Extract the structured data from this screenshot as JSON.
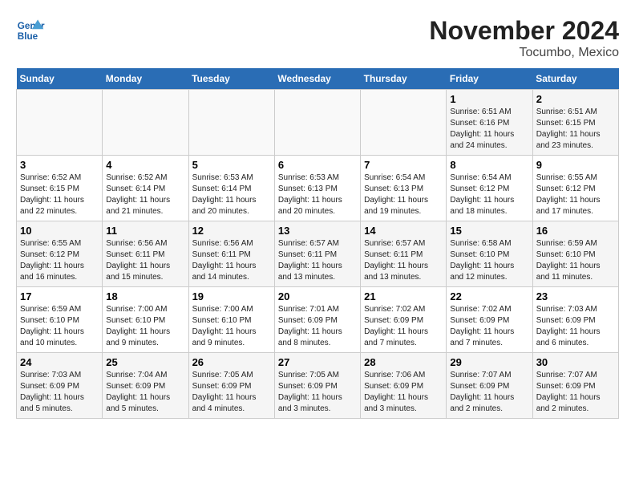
{
  "header": {
    "logo_line1": "General",
    "logo_line2": "Blue",
    "month": "November 2024",
    "location": "Tocumbo, Mexico"
  },
  "weekdays": [
    "Sunday",
    "Monday",
    "Tuesday",
    "Wednesday",
    "Thursday",
    "Friday",
    "Saturday"
  ],
  "weeks": [
    [
      {
        "day": "",
        "info": ""
      },
      {
        "day": "",
        "info": ""
      },
      {
        "day": "",
        "info": ""
      },
      {
        "day": "",
        "info": ""
      },
      {
        "day": "",
        "info": ""
      },
      {
        "day": "1",
        "info": "Sunrise: 6:51 AM\nSunset: 6:16 PM\nDaylight: 11 hours and 24 minutes."
      },
      {
        "day": "2",
        "info": "Sunrise: 6:51 AM\nSunset: 6:15 PM\nDaylight: 11 hours and 23 minutes."
      }
    ],
    [
      {
        "day": "3",
        "info": "Sunrise: 6:52 AM\nSunset: 6:15 PM\nDaylight: 11 hours and 22 minutes."
      },
      {
        "day": "4",
        "info": "Sunrise: 6:52 AM\nSunset: 6:14 PM\nDaylight: 11 hours and 21 minutes."
      },
      {
        "day": "5",
        "info": "Sunrise: 6:53 AM\nSunset: 6:14 PM\nDaylight: 11 hours and 20 minutes."
      },
      {
        "day": "6",
        "info": "Sunrise: 6:53 AM\nSunset: 6:13 PM\nDaylight: 11 hours and 20 minutes."
      },
      {
        "day": "7",
        "info": "Sunrise: 6:54 AM\nSunset: 6:13 PM\nDaylight: 11 hours and 19 minutes."
      },
      {
        "day": "8",
        "info": "Sunrise: 6:54 AM\nSunset: 6:12 PM\nDaylight: 11 hours and 18 minutes."
      },
      {
        "day": "9",
        "info": "Sunrise: 6:55 AM\nSunset: 6:12 PM\nDaylight: 11 hours and 17 minutes."
      }
    ],
    [
      {
        "day": "10",
        "info": "Sunrise: 6:55 AM\nSunset: 6:12 PM\nDaylight: 11 hours and 16 minutes."
      },
      {
        "day": "11",
        "info": "Sunrise: 6:56 AM\nSunset: 6:11 PM\nDaylight: 11 hours and 15 minutes."
      },
      {
        "day": "12",
        "info": "Sunrise: 6:56 AM\nSunset: 6:11 PM\nDaylight: 11 hours and 14 minutes."
      },
      {
        "day": "13",
        "info": "Sunrise: 6:57 AM\nSunset: 6:11 PM\nDaylight: 11 hours and 13 minutes."
      },
      {
        "day": "14",
        "info": "Sunrise: 6:57 AM\nSunset: 6:11 PM\nDaylight: 11 hours and 13 minutes."
      },
      {
        "day": "15",
        "info": "Sunrise: 6:58 AM\nSunset: 6:10 PM\nDaylight: 11 hours and 12 minutes."
      },
      {
        "day": "16",
        "info": "Sunrise: 6:59 AM\nSunset: 6:10 PM\nDaylight: 11 hours and 11 minutes."
      }
    ],
    [
      {
        "day": "17",
        "info": "Sunrise: 6:59 AM\nSunset: 6:10 PM\nDaylight: 11 hours and 10 minutes."
      },
      {
        "day": "18",
        "info": "Sunrise: 7:00 AM\nSunset: 6:10 PM\nDaylight: 11 hours and 9 minutes."
      },
      {
        "day": "19",
        "info": "Sunrise: 7:00 AM\nSunset: 6:10 PM\nDaylight: 11 hours and 9 minutes."
      },
      {
        "day": "20",
        "info": "Sunrise: 7:01 AM\nSunset: 6:09 PM\nDaylight: 11 hours and 8 minutes."
      },
      {
        "day": "21",
        "info": "Sunrise: 7:02 AM\nSunset: 6:09 PM\nDaylight: 11 hours and 7 minutes."
      },
      {
        "day": "22",
        "info": "Sunrise: 7:02 AM\nSunset: 6:09 PM\nDaylight: 11 hours and 7 minutes."
      },
      {
        "day": "23",
        "info": "Sunrise: 7:03 AM\nSunset: 6:09 PM\nDaylight: 11 hours and 6 minutes."
      }
    ],
    [
      {
        "day": "24",
        "info": "Sunrise: 7:03 AM\nSunset: 6:09 PM\nDaylight: 11 hours and 5 minutes."
      },
      {
        "day": "25",
        "info": "Sunrise: 7:04 AM\nSunset: 6:09 PM\nDaylight: 11 hours and 5 minutes."
      },
      {
        "day": "26",
        "info": "Sunrise: 7:05 AM\nSunset: 6:09 PM\nDaylight: 11 hours and 4 minutes."
      },
      {
        "day": "27",
        "info": "Sunrise: 7:05 AM\nSunset: 6:09 PM\nDaylight: 11 hours and 3 minutes."
      },
      {
        "day": "28",
        "info": "Sunrise: 7:06 AM\nSunset: 6:09 PM\nDaylight: 11 hours and 3 minutes."
      },
      {
        "day": "29",
        "info": "Sunrise: 7:07 AM\nSunset: 6:09 PM\nDaylight: 11 hours and 2 minutes."
      },
      {
        "day": "30",
        "info": "Sunrise: 7:07 AM\nSunset: 6:09 PM\nDaylight: 11 hours and 2 minutes."
      }
    ]
  ]
}
